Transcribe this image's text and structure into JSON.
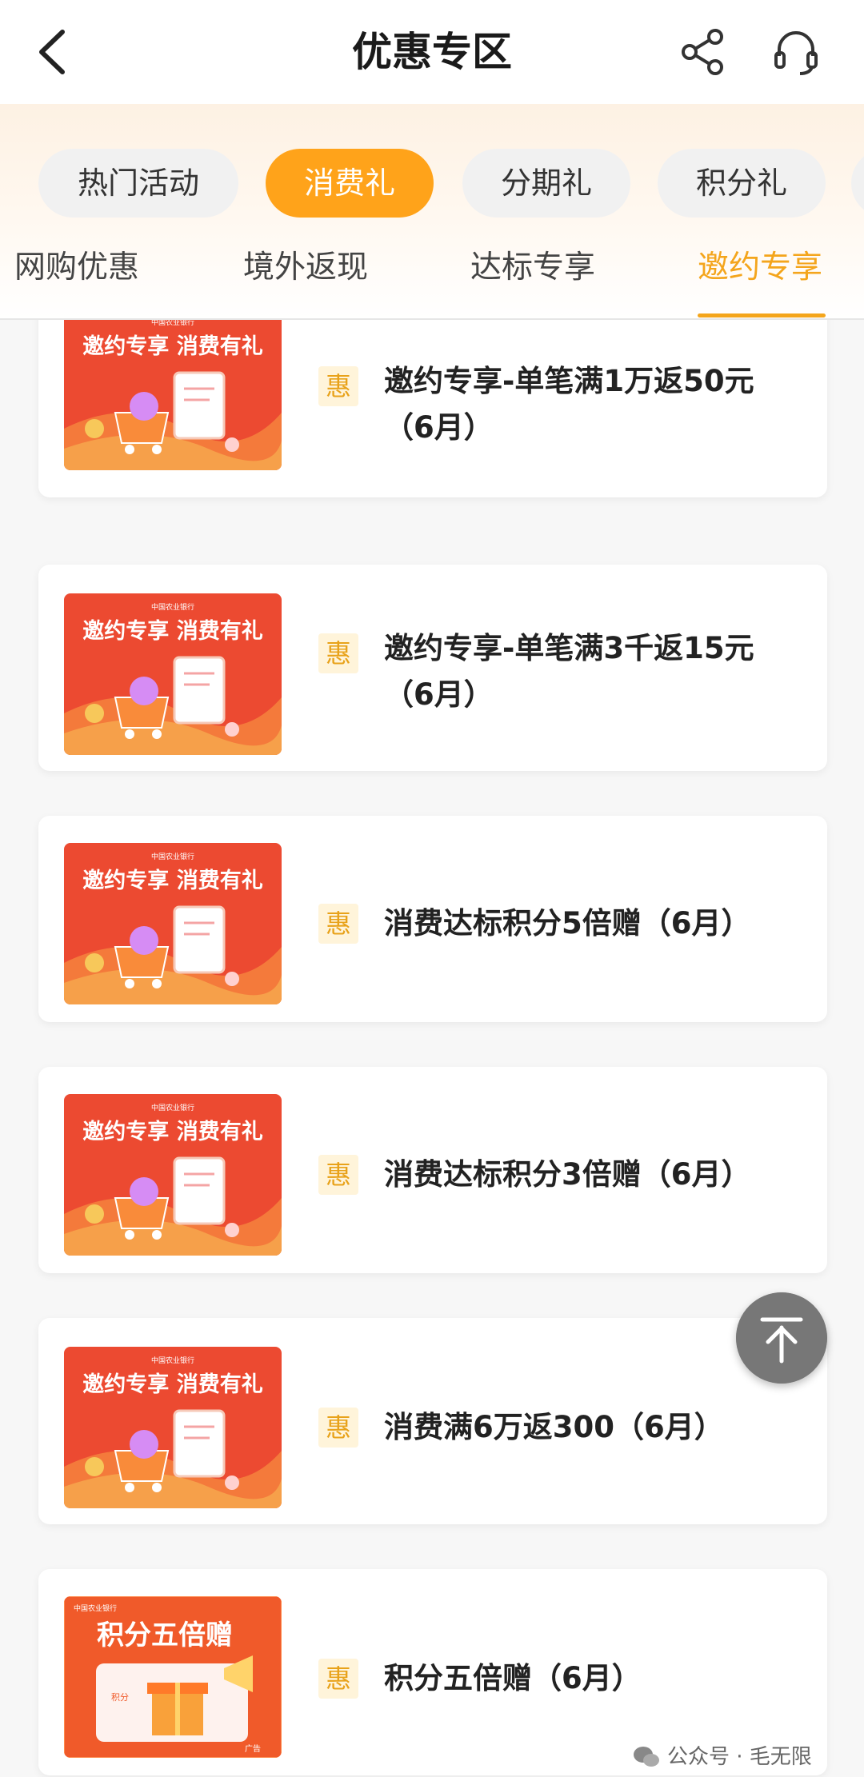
{
  "header": {
    "title": "优惠专区"
  },
  "category_tabs": [
    "热门活动",
    "消费礼",
    "分期礼",
    "积分礼"
  ],
  "sub_tabs": [
    "网购优惠",
    "境外返现",
    "达标专享",
    "邀约专享"
  ],
  "active_category": "消费礼",
  "active_sub_tab": "邀约专享",
  "badge_label": "惠",
  "banner": {
    "line_a": "邀约专享 消费有礼",
    "line_b": "积分五倍赠",
    "bank": "中国农业银行",
    "ad": "广告",
    "points": "积分"
  },
  "offers": [
    {
      "title_line1": "邀约专享-单笔满1万返50元",
      "title_line2": "（6月）",
      "banner": "invite"
    },
    {
      "title_line1": "邀约专享-单笔满3千返15元",
      "title_line2": "（6月）",
      "banner": "invite"
    },
    {
      "title_line1": "消费达标积分5倍赠（6月）",
      "title_line2": "",
      "banner": "invite"
    },
    {
      "title_line1": "消费达标积分3倍赠（6月）",
      "title_line2": "",
      "banner": "invite"
    },
    {
      "title_line1": "消费满6万返300（6月）",
      "title_line2": "",
      "banner": "invite"
    },
    {
      "title_line1": "积分五倍赠（6月）",
      "title_line2": "",
      "banner": "points"
    }
  ],
  "watermark": "公众号 · 毛无限",
  "colors": {
    "accent": "#ffa31a",
    "active_sub_tab": "#f4a51c",
    "badge_bg": "#fff4da",
    "banner_red": "#e8452f"
  }
}
